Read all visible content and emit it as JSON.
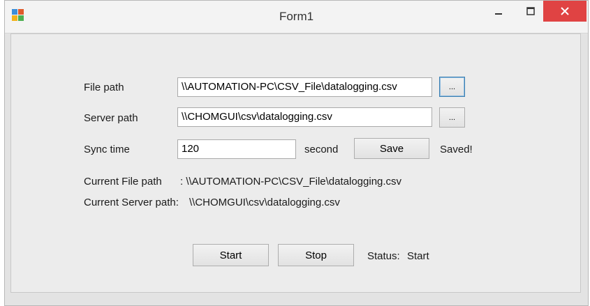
{
  "window": {
    "title": "Form1"
  },
  "form": {
    "file_path_label": "File path",
    "file_path_value": "\\\\AUTOMATION-PC\\CSV_File\\datalogging.csv",
    "server_path_label": "Server path",
    "server_path_value": "\\\\CHOMGUI\\csv\\datalogging.csv",
    "sync_time_label": "Sync time",
    "sync_time_value": "120",
    "sync_unit": "second",
    "browse_label": "...",
    "save_label": "Save",
    "save_status": "Saved!",
    "current_file_label": "Current File path",
    "current_file_value": ":  \\\\AUTOMATION-PC\\CSV_File\\datalogging.csv",
    "current_server_label": "Current Server path:",
    "current_server_value": "\\\\CHOMGUI\\csv\\datalogging.csv",
    "start_label": "Start",
    "stop_label": "Stop",
    "status_label": "Status:",
    "status_value": "Start"
  },
  "colors": {
    "close": "#e04343"
  }
}
